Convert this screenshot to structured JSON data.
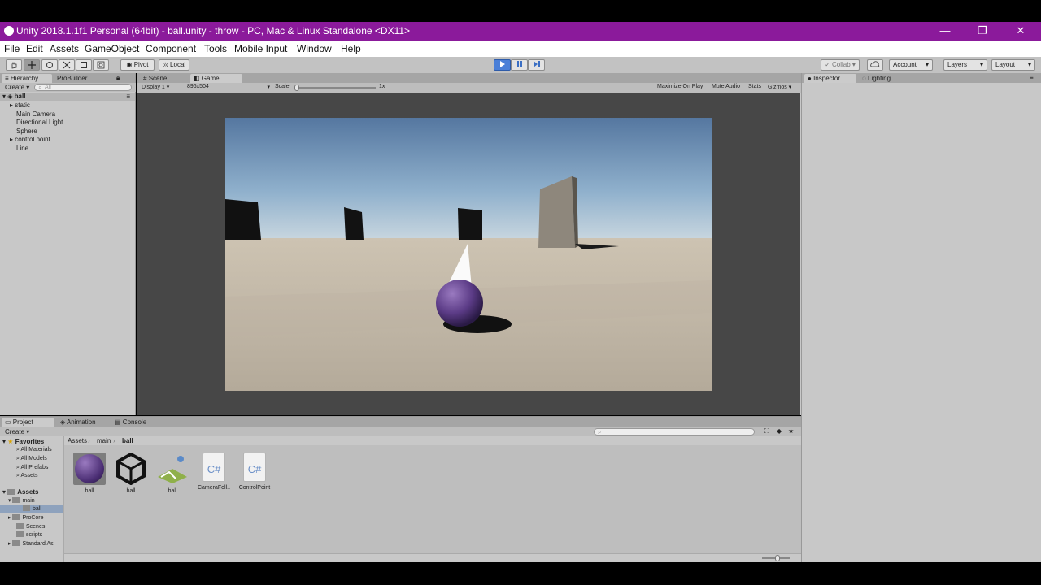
{
  "window": {
    "title": "Unity 2018.1.1f1 Personal (64bit) - ball.unity - throw - PC, Mac & Linux Standalone <DX11>",
    "minimize": "—",
    "restore": "❐",
    "close": "✕"
  },
  "menu": [
    "File",
    "Edit",
    "Assets",
    "GameObject",
    "Component",
    "Tools",
    "Mobile Input",
    "Window",
    "Help"
  ],
  "toolbar": {
    "pivot": "Pivot",
    "local": "Local",
    "collab": "Collab",
    "account": "Account",
    "layers": "Layers",
    "layout": "Layout"
  },
  "hierarchy": {
    "tab1": "Hierarchy",
    "tab2": "ProBuilder",
    "create": "Create",
    "search_placeholder": "All",
    "scene": "ball",
    "items": [
      "static",
      "Main Camera",
      "Directional Light",
      "Sphere",
      "control point",
      "Line"
    ]
  },
  "game": {
    "tab_scene": "Scene",
    "tab_game": "Game",
    "display": "Display 1",
    "resolution": "896x504",
    "scale_label": "Scale",
    "scale_value": "1x",
    "maximize": "Maximize On Play",
    "mute": "Mute Audio",
    "stats": "Stats",
    "gizmos": "Gizmos"
  },
  "inspector": {
    "tab1": "Inspector",
    "tab2": "Lighting"
  },
  "project": {
    "tab1": "Project",
    "tab2": "Animation",
    "tab3": "Console",
    "create": "Create",
    "breadcrumb": [
      "Assets",
      "main",
      "ball"
    ],
    "favorites_label": "Favorites",
    "favorites": [
      "All Materials",
      "All Models",
      "All Prefabs",
      "Assets"
    ],
    "assets_label": "Assets",
    "tree": [
      "main",
      "ball",
      "ProCore",
      "Scenes",
      "scripts",
      "Standard As"
    ],
    "assets": [
      {
        "name": "ball",
        "kind": "material"
      },
      {
        "name": "ball",
        "kind": "unity-scene"
      },
      {
        "name": "ball",
        "kind": "lighting-data"
      },
      {
        "name": "CameraFoll..",
        "kind": "csharp",
        "glyph": "C#"
      },
      {
        "name": "ControlPoint",
        "kind": "csharp",
        "glyph": "C#"
      }
    ]
  },
  "colors": {
    "titlebar": "#8b1a9b",
    "panel": "#c8c8c8",
    "play_active": "#4a7fd8"
  }
}
